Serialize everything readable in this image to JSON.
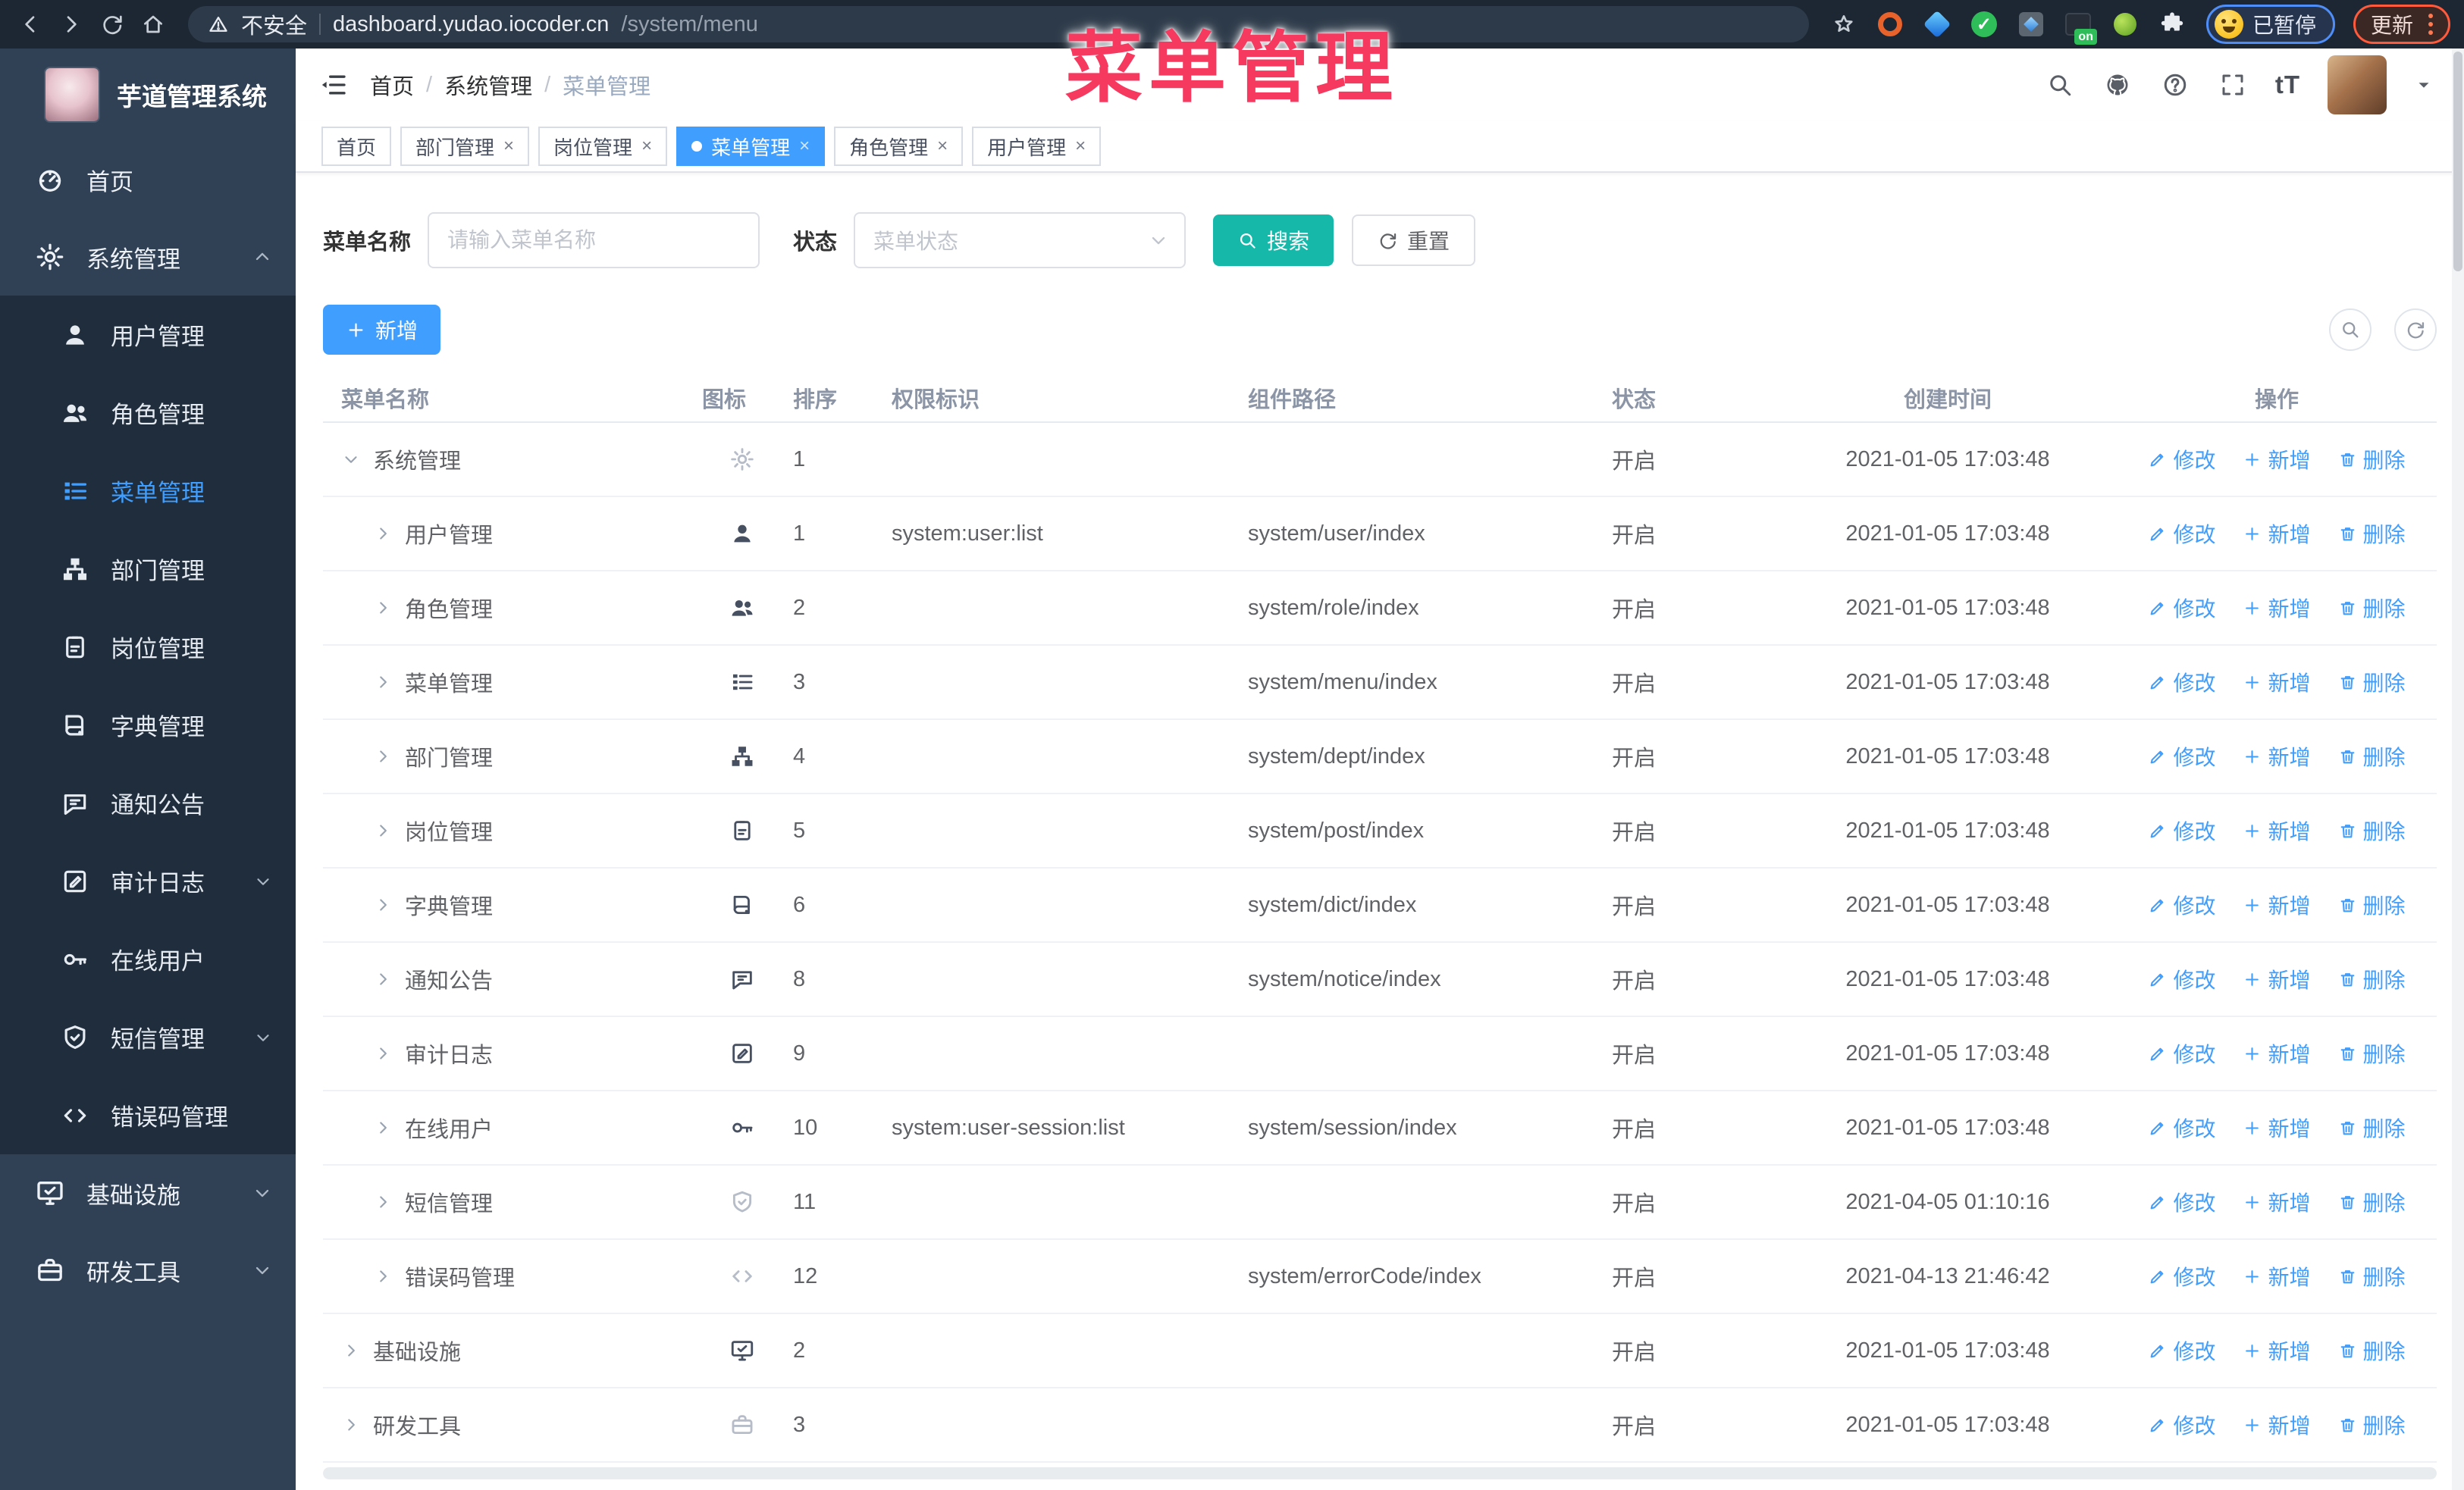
{
  "browser": {
    "security_label": "不安全",
    "url_host": "dashboard.yudao.iocoder.cn",
    "url_path": "/system/menu",
    "paused_label": "已暂停",
    "update_label": "更新"
  },
  "overlay_title": "菜单管理",
  "sidebar": {
    "logo_title": "芋道管理系统",
    "items": [
      {
        "label": "首页",
        "icon": "dashboard"
      },
      {
        "label": "系统管理",
        "icon": "gear",
        "expanded": true,
        "arrow": "up",
        "children": [
          {
            "label": "用户管理",
            "icon": "user"
          },
          {
            "label": "角色管理",
            "icon": "users"
          },
          {
            "label": "菜单管理",
            "icon": "list",
            "active": true
          },
          {
            "label": "部门管理",
            "icon": "tree"
          },
          {
            "label": "岗位管理",
            "icon": "badge"
          },
          {
            "label": "字典管理",
            "icon": "book"
          },
          {
            "label": "通知公告",
            "icon": "chat"
          },
          {
            "label": "审计日志",
            "icon": "edit",
            "arrow": "down"
          },
          {
            "label": "在线用户",
            "icon": "key"
          },
          {
            "label": "短信管理",
            "icon": "shield",
            "arrow": "down"
          },
          {
            "label": "错误码管理",
            "icon": "code"
          }
        ]
      },
      {
        "label": "基础设施",
        "icon": "monitor",
        "arrow": "down"
      },
      {
        "label": "研发工具",
        "icon": "briefcase",
        "arrow": "down"
      }
    ]
  },
  "header": {
    "breadcrumb": [
      "首页",
      "系统管理",
      "菜单管理"
    ]
  },
  "tags": [
    {
      "label": "首页",
      "closable": false,
      "active": false
    },
    {
      "label": "部门管理",
      "closable": true,
      "active": false
    },
    {
      "label": "岗位管理",
      "closable": true,
      "active": false
    },
    {
      "label": "菜单管理",
      "closable": true,
      "active": true
    },
    {
      "label": "角色管理",
      "closable": true,
      "active": false
    },
    {
      "label": "用户管理",
      "closable": true,
      "active": false
    }
  ],
  "search": {
    "name_label": "菜单名称",
    "name_placeholder": "请输入菜单名称",
    "status_label": "状态",
    "status_placeholder": "菜单状态",
    "search_button": "搜索",
    "reset_button": "重置"
  },
  "toolbar": {
    "add_button": "新增"
  },
  "table": {
    "headers": [
      "菜单名称",
      "图标",
      "排序",
      "权限标识",
      "组件路径",
      "状态",
      "创建时间",
      "操作"
    ],
    "op_labels": {
      "edit": "修改",
      "add": "新增",
      "delete": "删除"
    },
    "rows": [
      {
        "name": "系统管理",
        "level": 0,
        "arrow": "down",
        "icon": "gear",
        "icon_light": true,
        "order": "1",
        "perm": "",
        "path": "",
        "status": "开启",
        "created": "2021-01-05 17:03:48"
      },
      {
        "name": "用户管理",
        "level": 1,
        "arrow": "right",
        "icon": "user",
        "icon_light": false,
        "order": "1",
        "perm": "system:user:list",
        "path": "system/user/index",
        "status": "开启",
        "created": "2021-01-05 17:03:48"
      },
      {
        "name": "角色管理",
        "level": 1,
        "arrow": "right",
        "icon": "users",
        "icon_light": false,
        "order": "2",
        "perm": "",
        "path": "system/role/index",
        "status": "开启",
        "created": "2021-01-05 17:03:48"
      },
      {
        "name": "菜单管理",
        "level": 1,
        "arrow": "right",
        "icon": "list",
        "icon_light": false,
        "order": "3",
        "perm": "",
        "path": "system/menu/index",
        "status": "开启",
        "created": "2021-01-05 17:03:48"
      },
      {
        "name": "部门管理",
        "level": 1,
        "arrow": "right",
        "icon": "tree",
        "icon_light": false,
        "order": "4",
        "perm": "",
        "path": "system/dept/index",
        "status": "开启",
        "created": "2021-01-05 17:03:48"
      },
      {
        "name": "岗位管理",
        "level": 1,
        "arrow": "right",
        "icon": "badge",
        "icon_light": false,
        "order": "5",
        "perm": "",
        "path": "system/post/index",
        "status": "开启",
        "created": "2021-01-05 17:03:48"
      },
      {
        "name": "字典管理",
        "level": 1,
        "arrow": "right",
        "icon": "book",
        "icon_light": false,
        "order": "6",
        "perm": "",
        "path": "system/dict/index",
        "status": "开启",
        "created": "2021-01-05 17:03:48"
      },
      {
        "name": "通知公告",
        "level": 1,
        "arrow": "right",
        "icon": "chat",
        "icon_light": false,
        "order": "8",
        "perm": "",
        "path": "system/notice/index",
        "status": "开启",
        "created": "2021-01-05 17:03:48"
      },
      {
        "name": "审计日志",
        "level": 1,
        "arrow": "right",
        "icon": "edit",
        "icon_light": false,
        "order": "9",
        "perm": "",
        "path": "",
        "status": "开启",
        "created": "2021-01-05 17:03:48"
      },
      {
        "name": "在线用户",
        "level": 1,
        "arrow": "right",
        "icon": "key",
        "icon_light": false,
        "order": "10",
        "perm": "system:user-session:list",
        "path": "system/session/index",
        "status": "开启",
        "created": "2021-01-05 17:03:48"
      },
      {
        "name": "短信管理",
        "level": 1,
        "arrow": "right",
        "icon": "shield",
        "icon_light": true,
        "order": "11",
        "perm": "",
        "path": "",
        "status": "开启",
        "created": "2021-04-05 01:10:16"
      },
      {
        "name": "错误码管理",
        "level": 1,
        "arrow": "right",
        "icon": "code",
        "icon_light": true,
        "order": "12",
        "perm": "",
        "path": "system/errorCode/index",
        "status": "开启",
        "created": "2021-04-13 21:46:42"
      },
      {
        "name": "基础设施",
        "level": 0,
        "arrow": "right",
        "icon": "monitor",
        "icon_light": false,
        "order": "2",
        "perm": "",
        "path": "",
        "status": "开启",
        "created": "2021-01-05 17:03:48"
      },
      {
        "name": "研发工具",
        "level": 0,
        "arrow": "right",
        "icon": "briefcase",
        "icon_light": true,
        "order": "3",
        "perm": "",
        "path": "",
        "status": "开启",
        "created": "2021-01-05 17:03:48"
      }
    ]
  },
  "colors": {
    "accent_blue": "#409eff",
    "search_teal": "#16b8aa",
    "overlay_pink": "#f5395f",
    "sidebar_bg": "#304156",
    "submenu_bg": "#1f2d3d"
  }
}
